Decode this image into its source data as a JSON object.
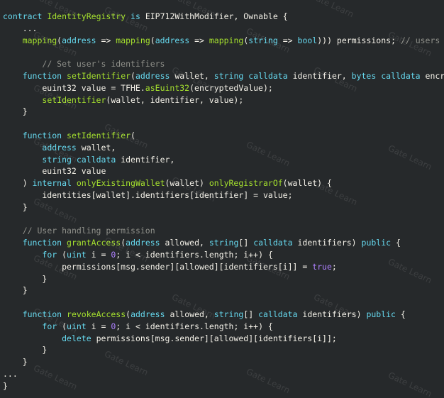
{
  "editor": {
    "lines": [
      [
        [
          "kw",
          "contract"
        ],
        [
          "pl",
          " "
        ],
        [
          "fn",
          "IdentityRegistry"
        ],
        [
          "pl",
          " "
        ],
        [
          "kw",
          "is"
        ],
        [
          "pl",
          " EIP712WithModifier, Ownable {"
        ]
      ],
      [
        [
          "pl",
          "    ..."
        ]
      ],
      [
        [
          "pl",
          "    "
        ],
        [
          "fn",
          "mapping"
        ],
        [
          "pl",
          "("
        ],
        [
          "kw",
          "address"
        ],
        [
          "pl",
          " => "
        ],
        [
          "fn",
          "mapping"
        ],
        [
          "pl",
          "("
        ],
        [
          "kw",
          "address"
        ],
        [
          "pl",
          " => "
        ],
        [
          "fn",
          "mapping"
        ],
        [
          "pl",
          "("
        ],
        [
          "kw",
          "string"
        ],
        [
          "pl",
          " => "
        ],
        [
          "kw",
          "bool"
        ],
        [
          "pl",
          ")))"
        ],
        [
          "pl",
          " permissions; "
        ],
        [
          "cm",
          "// users =>"
        ]
      ],
      [
        [
          "pl",
          ""
        ]
      ],
      [
        [
          "pl",
          "        "
        ],
        [
          "cm",
          "// Set user's identifiers"
        ]
      ],
      [
        [
          "pl",
          "    "
        ],
        [
          "kw",
          "function"
        ],
        [
          "pl",
          " "
        ],
        [
          "fn",
          "setIdentifier"
        ],
        [
          "pl",
          "("
        ],
        [
          "kw",
          "address"
        ],
        [
          "pl",
          " wallet, "
        ],
        [
          "kw",
          "string"
        ],
        [
          "pl",
          " "
        ],
        [
          "kw",
          "calldata"
        ],
        [
          "pl",
          " identifier, "
        ],
        [
          "kw",
          "bytes"
        ],
        [
          "pl",
          " "
        ],
        [
          "kw",
          "calldata"
        ],
        [
          "pl",
          " encrypt"
        ]
      ],
      [
        [
          "pl",
          "        euint32 value = TFHE."
        ],
        [
          "fn",
          "asEuint32"
        ],
        [
          "pl",
          "(encryptedValue);"
        ]
      ],
      [
        [
          "pl",
          "        "
        ],
        [
          "fn",
          "setIdentifier"
        ],
        [
          "pl",
          "(wallet, identifier, value);"
        ]
      ],
      [
        [
          "pl",
          "    }"
        ]
      ],
      [
        [
          "pl",
          ""
        ]
      ],
      [
        [
          "pl",
          "    "
        ],
        [
          "kw",
          "function"
        ],
        [
          "pl",
          " "
        ],
        [
          "fn",
          "setIdentifier"
        ],
        [
          "pl",
          "("
        ]
      ],
      [
        [
          "pl",
          "        "
        ],
        [
          "kw",
          "address"
        ],
        [
          "pl",
          " wallet,"
        ]
      ],
      [
        [
          "pl",
          "        "
        ],
        [
          "kw",
          "string"
        ],
        [
          "pl",
          " "
        ],
        [
          "kw",
          "calldata"
        ],
        [
          "pl",
          " identifier,"
        ]
      ],
      [
        [
          "pl",
          "        euint32 value"
        ]
      ],
      [
        [
          "pl",
          "    ) "
        ],
        [
          "kw",
          "internal"
        ],
        [
          "pl",
          " "
        ],
        [
          "fn",
          "onlyExistingWallet"
        ],
        [
          "pl",
          "(wallet) "
        ],
        [
          "fn",
          "onlyRegistrarOf"
        ],
        [
          "pl",
          "(wallet) {"
        ]
      ],
      [
        [
          "pl",
          "        identities[wallet].identifiers[identifier] = value;"
        ]
      ],
      [
        [
          "pl",
          "    }"
        ]
      ],
      [
        [
          "pl",
          ""
        ]
      ],
      [
        [
          "pl",
          "    "
        ],
        [
          "cm",
          "// User handling permission"
        ]
      ],
      [
        [
          "pl",
          "    "
        ],
        [
          "kw",
          "function"
        ],
        [
          "pl",
          " "
        ],
        [
          "fn",
          "grantAccess"
        ],
        [
          "pl",
          "("
        ],
        [
          "kw",
          "address"
        ],
        [
          "pl",
          " allowed, "
        ],
        [
          "kw",
          "string"
        ],
        [
          "pl",
          "[] "
        ],
        [
          "kw",
          "calldata"
        ],
        [
          "pl",
          " identifiers) "
        ],
        [
          "kw",
          "public"
        ],
        [
          "pl",
          " {"
        ]
      ],
      [
        [
          "pl",
          "        "
        ],
        [
          "kw",
          "for"
        ],
        [
          "pl",
          " ("
        ],
        [
          "kw",
          "uint"
        ],
        [
          "pl",
          " i = "
        ],
        [
          "num",
          "0"
        ],
        [
          "pl",
          "; i < identifiers.length; i++) {"
        ]
      ],
      [
        [
          "pl",
          "            permissions[msg.sender][allowed][identifiers[i]] = "
        ],
        [
          "bool",
          "true"
        ],
        [
          "pl",
          ";"
        ]
      ],
      [
        [
          "pl",
          "        }"
        ]
      ],
      [
        [
          "pl",
          "    }"
        ]
      ],
      [
        [
          "pl",
          ""
        ]
      ],
      [
        [
          "pl",
          "    "
        ],
        [
          "kw",
          "function"
        ],
        [
          "pl",
          " "
        ],
        [
          "fn",
          "revokeAccess"
        ],
        [
          "pl",
          "("
        ],
        [
          "kw",
          "address"
        ],
        [
          "pl",
          " allowed, "
        ],
        [
          "kw",
          "string"
        ],
        [
          "pl",
          "[] "
        ],
        [
          "kw",
          "calldata"
        ],
        [
          "pl",
          " identifiers) "
        ],
        [
          "kw",
          "public"
        ],
        [
          "pl",
          " {"
        ]
      ],
      [
        [
          "pl",
          "        "
        ],
        [
          "kw",
          "for"
        ],
        [
          "pl",
          " ("
        ],
        [
          "kw",
          "uint"
        ],
        [
          "pl",
          " i = "
        ],
        [
          "num",
          "0"
        ],
        [
          "pl",
          "; i < identifiers.length; i++) {"
        ]
      ],
      [
        [
          "pl",
          "            "
        ],
        [
          "kw",
          "delete"
        ],
        [
          "pl",
          " permissions[msg.sender][allowed][identifiers[i]];"
        ]
      ],
      [
        [
          "pl",
          "        }"
        ]
      ],
      [
        [
          "pl",
          "    }"
        ]
      ],
      [
        [
          "pl",
          "..."
        ]
      ],
      [
        [
          "pl",
          "}"
        ]
      ]
    ]
  },
  "watermark": {
    "text": "Gate Learn"
  },
  "colors": {
    "background": "#26292b",
    "keyword": "#66d9ef",
    "function": "#a6e22e",
    "number": "#ae81ff",
    "comment": "#8f908a",
    "text": "#f4f1e8"
  }
}
